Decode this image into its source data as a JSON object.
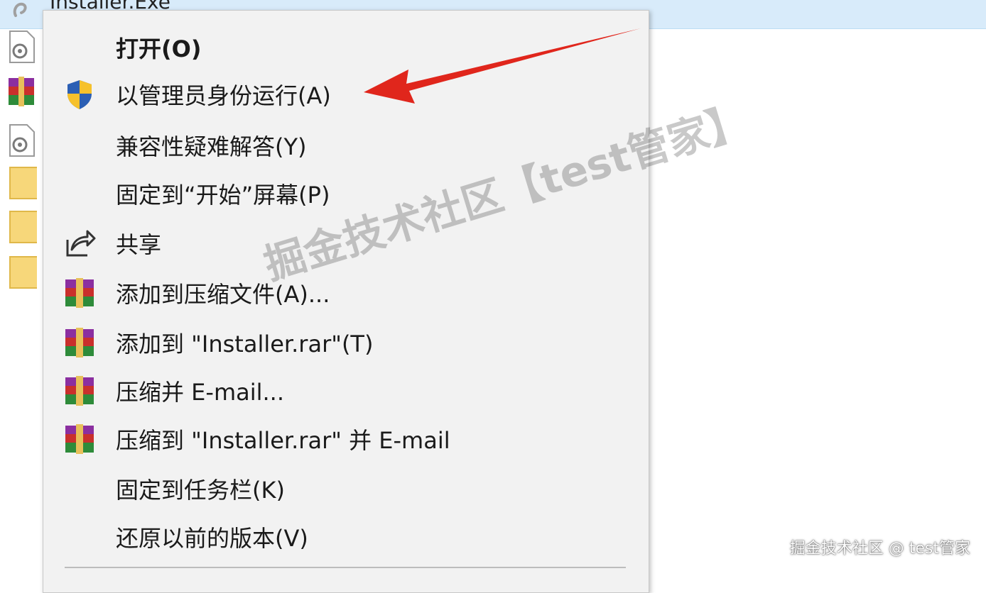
{
  "explorer": {
    "selected_file_name": "Installer.Exe"
  },
  "context_menu": {
    "items": [
      {
        "label": "打开(O)",
        "icon": "none"
      },
      {
        "label": "以管理员身份运行(A)",
        "icon": "uac-shield-icon"
      },
      {
        "label": "兼容性疑难解答(Y)",
        "icon": "none"
      },
      {
        "label": "固定到“开始”屏幕(P)",
        "icon": "none"
      },
      {
        "label": "共享",
        "icon": "share-icon"
      },
      {
        "label": "添加到压缩文件(A)...",
        "icon": "winrar-icon"
      },
      {
        "label": "添加到 \"Installer.rar\"(T)",
        "icon": "winrar-icon"
      },
      {
        "label": "压缩并 E-mail...",
        "icon": "winrar-icon"
      },
      {
        "label": "压缩到 \"Installer.rar\" 并 E-mail",
        "icon": "winrar-icon"
      },
      {
        "label": "固定到任务栏(K)",
        "icon": "none"
      },
      {
        "label": "还原以前的版本(V)",
        "icon": "none"
      }
    ]
  },
  "watermark": {
    "text": "掘金技术社区【test管家】",
    "credit": "掘金技术社区 @ test管家"
  },
  "colors": {
    "menu_background": "#f2f2f2",
    "selection_highlight": "#d8ebfa",
    "arrow_red": "#e0261c",
    "shield_blue": "#2b5fb4",
    "shield_yellow": "#f6c12b"
  }
}
